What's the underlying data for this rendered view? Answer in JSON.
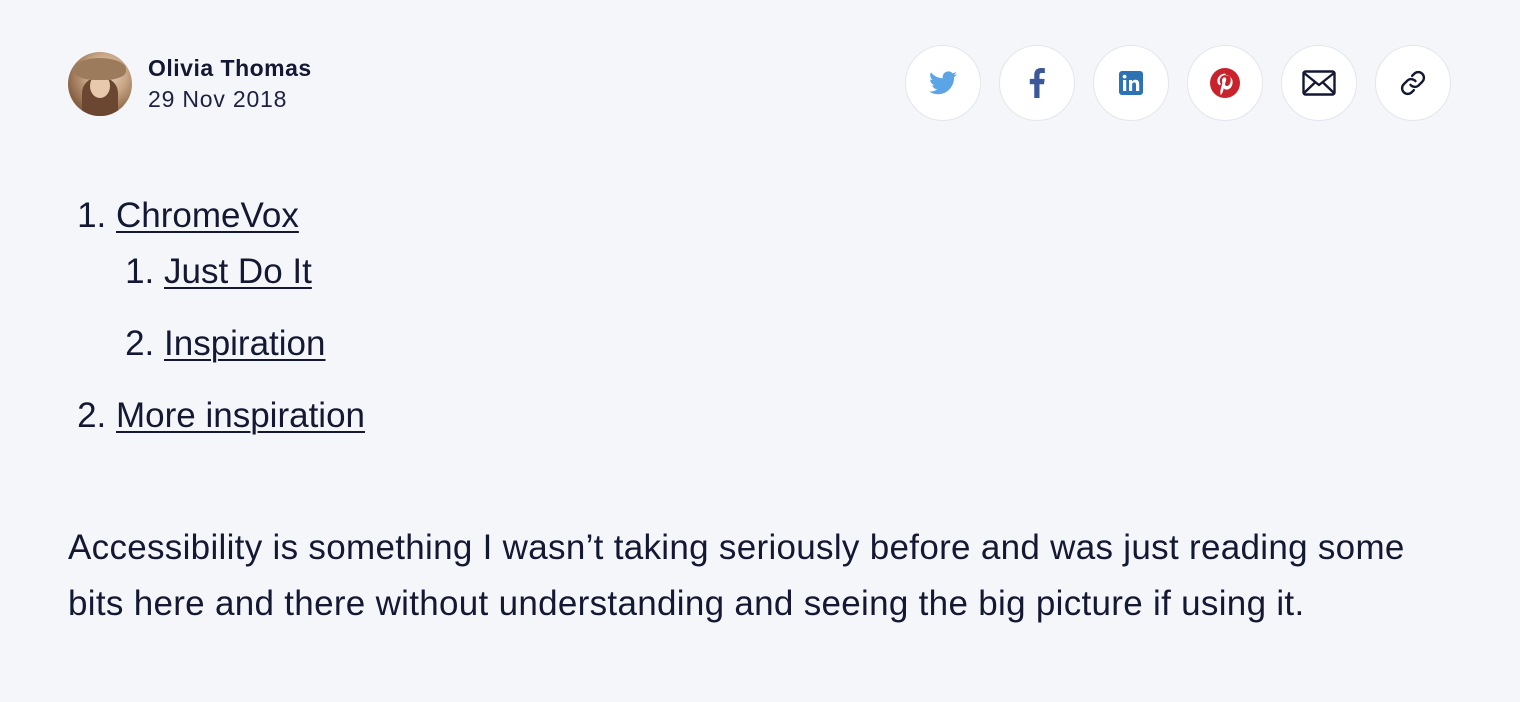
{
  "author": {
    "name": "Olivia Thomas",
    "date": "29 Nov 2018"
  },
  "share_buttons": [
    {
      "icon": "twitter-icon",
      "label": "Share on Twitter",
      "color": "#5ba4e5"
    },
    {
      "icon": "facebook-icon",
      "label": "Share on Facebook",
      "color": "#3b5998"
    },
    {
      "icon": "linkedin-icon",
      "label": "Share on LinkedIn",
      "color": "#2d73b4"
    },
    {
      "icon": "pinterest-icon",
      "label": "Share on Pinterest",
      "color": "#c8232c"
    },
    {
      "icon": "email-icon",
      "label": "Share via email",
      "color": "#151833"
    },
    {
      "icon": "link-icon",
      "label": "Copy link",
      "color": "#151833"
    }
  ],
  "list": {
    "items": [
      {
        "label": "ChromeVox",
        "children": [
          {
            "label": "Just Do It"
          },
          {
            "label": "Inspiration"
          }
        ]
      },
      {
        "label": "More inspiration"
      }
    ]
  },
  "body": {
    "paragraph": "Accessibility is something I wasn’t taking seriously before and was just reading some bits here and there without understanding and seeing the big picture if using it."
  }
}
